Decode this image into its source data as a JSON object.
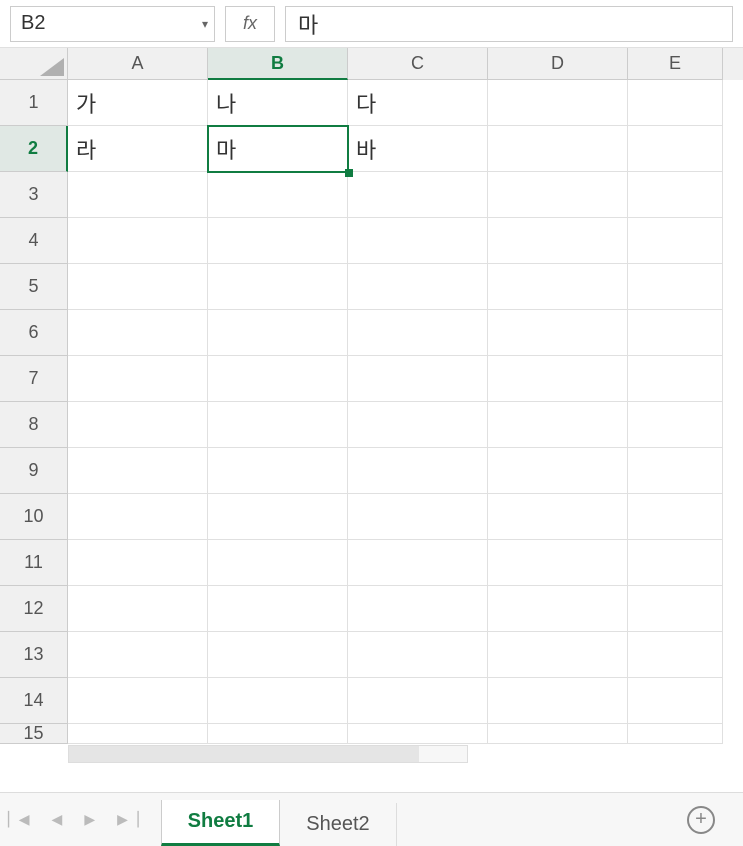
{
  "formula_bar": {
    "name_box": "B2",
    "fx_label": "fx",
    "formula_value": "마"
  },
  "columns": [
    "A",
    "B",
    "C",
    "D",
    "E"
  ],
  "active_col_index": 1,
  "rows": [
    1,
    2,
    3,
    4,
    5,
    6,
    7,
    8,
    9,
    10,
    11,
    12,
    13,
    14,
    15
  ],
  "active_row_index": 1,
  "cells": {
    "A1": "가",
    "B1": "나",
    "C1": "다",
    "A2": "라",
    "B2": "마",
    "C2": "바"
  },
  "active_cell": "B2",
  "sheets": {
    "tabs": [
      "Sheet1",
      "Sheet2"
    ],
    "active_index": 0
  },
  "nav_icons": {
    "first": "first-icon",
    "prev": "prev-icon",
    "next": "next-icon",
    "last": "last-icon"
  },
  "add_sheet_label": "+"
}
